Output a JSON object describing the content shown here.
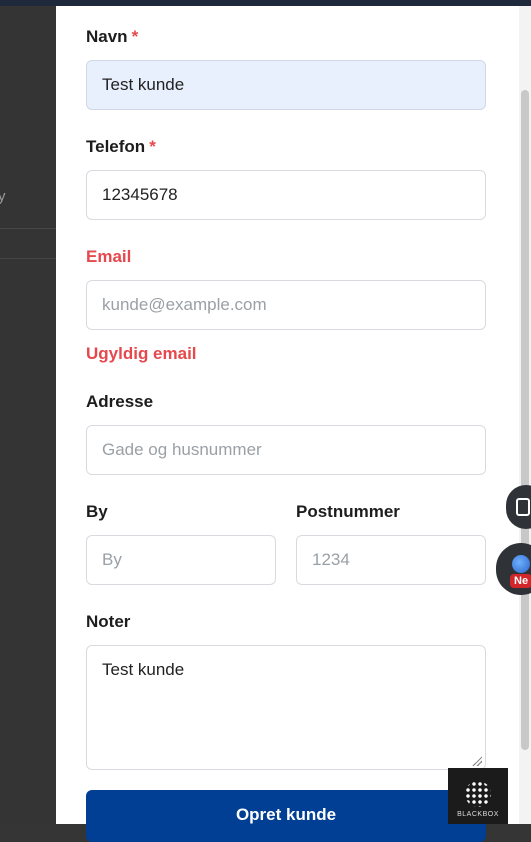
{
  "form": {
    "name": {
      "label": "Navn",
      "required": "*",
      "value": "Test kunde"
    },
    "phone": {
      "label": "Telefon",
      "required": "*",
      "value": "12345678"
    },
    "email": {
      "label": "Email",
      "placeholder": "kunde@example.com",
      "error": "Ugyldig email"
    },
    "address": {
      "label": "Adresse",
      "placeholder": "Gade og husnummer"
    },
    "city": {
      "label": "By",
      "placeholder": "By"
    },
    "zip": {
      "label": "Postnummer",
      "placeholder": "1234"
    },
    "notes": {
      "label": "Noter",
      "value": "Test kunde"
    },
    "submit_label": "Opret kunde"
  },
  "backdrop": {
    "fragment": "y"
  },
  "widgets": {
    "new_badge": "Ne"
  },
  "watermark": {
    "text": "BLACKBOX"
  },
  "colors": {
    "primary": "#003f94",
    "error": "#e5484d",
    "autofill": "#e8f0fe"
  },
  "icons": [
    "book-icon",
    "globe-icon",
    "resize-handle-icon"
  ]
}
